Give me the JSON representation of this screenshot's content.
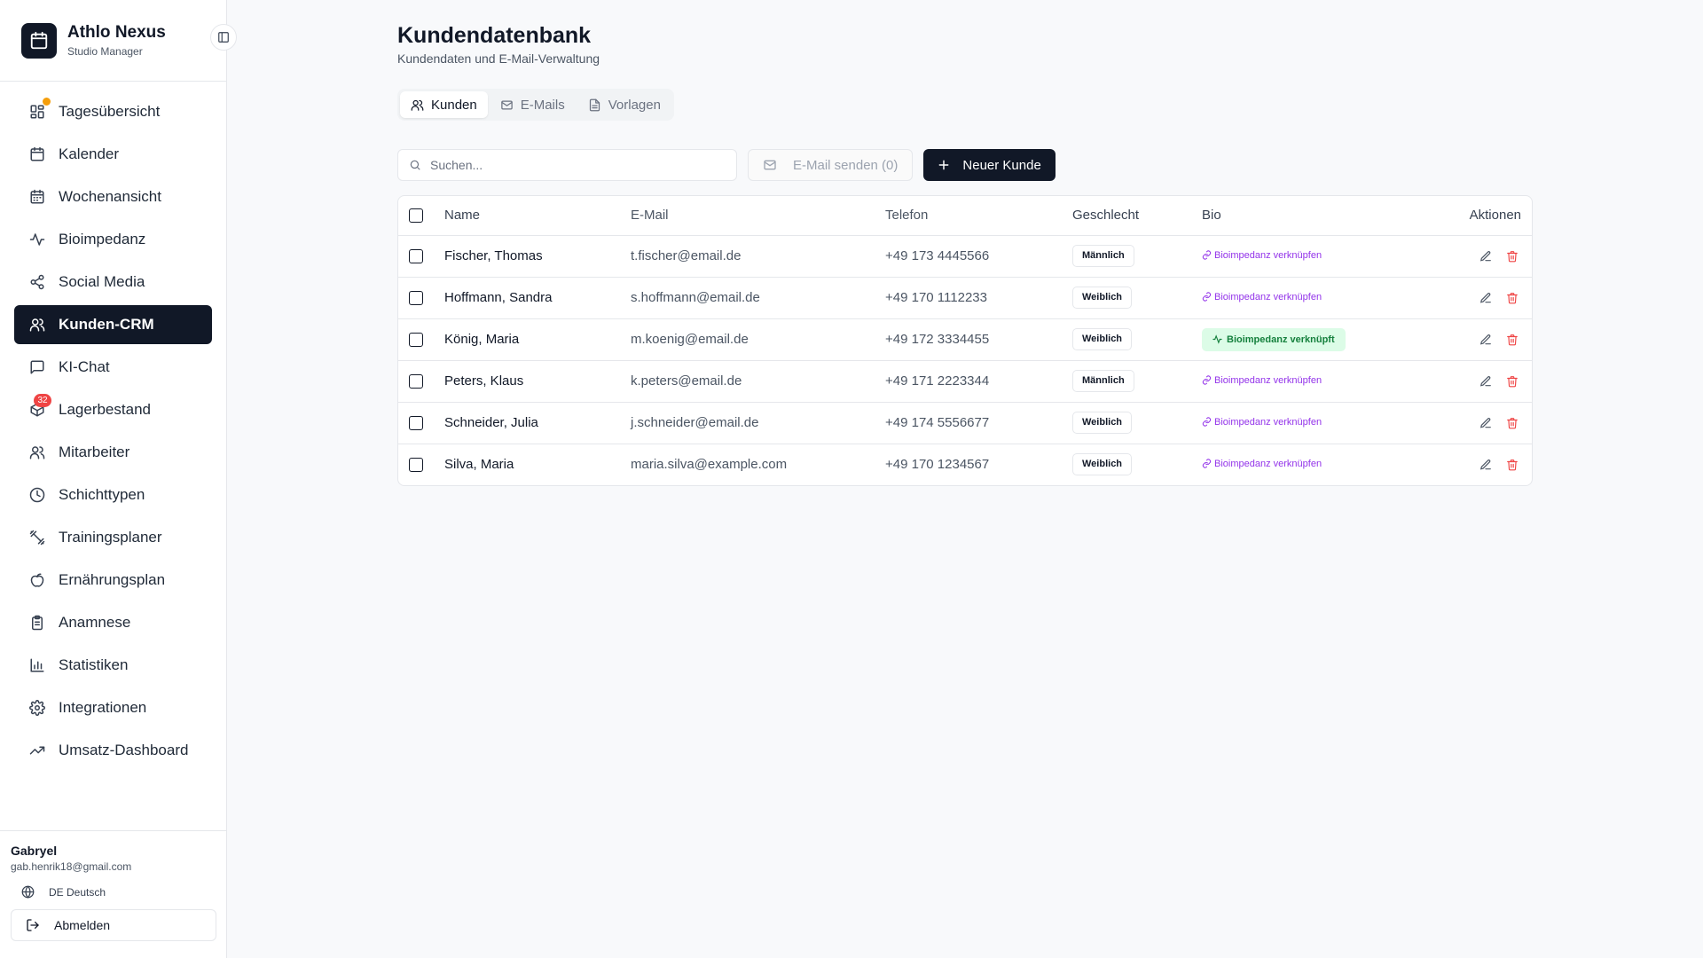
{
  "app": {
    "title": "Athlo Nexus",
    "subtitle": "Studio Manager"
  },
  "sidebar": {
    "items": [
      {
        "label": "Tagesübersicht",
        "icon": "grid-icon",
        "active": false,
        "badge_dot": true
      },
      {
        "label": "Kalender",
        "icon": "calendar-icon",
        "active": false
      },
      {
        "label": "Wochenansicht",
        "icon": "calendar-week-icon",
        "active": false
      },
      {
        "label": "Bioimpedanz",
        "icon": "activity-icon",
        "active": false
      },
      {
        "label": "Social Media",
        "icon": "share-icon",
        "active": false
      },
      {
        "label": "Kunden-CRM",
        "icon": "users-icon",
        "active": true
      },
      {
        "label": "KI-Chat",
        "icon": "chat-icon",
        "active": false
      },
      {
        "label": "Lagerbestand",
        "icon": "package-icon",
        "active": false,
        "badge": "32"
      },
      {
        "label": "Mitarbeiter",
        "icon": "users-icon",
        "active": false
      },
      {
        "label": "Schichttypen",
        "icon": "clock-icon",
        "active": false
      },
      {
        "label": "Trainingsplaner",
        "icon": "dumbbell-icon",
        "active": false
      },
      {
        "label": "Ernährungsplan",
        "icon": "apple-icon",
        "active": false
      },
      {
        "label": "Anamnese",
        "icon": "clipboard-icon",
        "active": false
      },
      {
        "label": "Statistiken",
        "icon": "bar-chart-icon",
        "active": false
      },
      {
        "label": "Integrationen",
        "icon": "settings-icon",
        "active": false
      },
      {
        "label": "Umsatz-Dashboard",
        "icon": "trending-up-icon",
        "active": false
      }
    ]
  },
  "user": {
    "name": "Gabryel",
    "email": "gab.henrik18@gmail.com",
    "language": "DE Deutsch",
    "logout_label": "Abmelden"
  },
  "page": {
    "title": "Kundendatenbank",
    "subtitle": "Kundendaten und E-Mail-Verwaltung"
  },
  "tabs": [
    {
      "label": "Kunden",
      "icon": "users-icon",
      "active": true
    },
    {
      "label": "E-Mails",
      "icon": "mail-icon",
      "active": false
    },
    {
      "label": "Vorlagen",
      "icon": "file-icon",
      "active": false
    }
  ],
  "toolbar": {
    "search_placeholder": "Suchen...",
    "send_email_label": "E-Mail senden (0)",
    "new_customer_label": "Neuer Kunde"
  },
  "table": {
    "columns": [
      "Name",
      "E-Mail",
      "Telefon",
      "Geschlecht",
      "Bio",
      "Aktionen"
    ],
    "rows": [
      {
        "name": "Fischer, Thomas",
        "email": "t.fischer@email.de",
        "phone": "+49 173 4445566",
        "gender": "Männlich",
        "bio": "Bioimpedanz verknüpfen",
        "bio_linked": false
      },
      {
        "name": "Hoffmann, Sandra",
        "email": "s.hoffmann@email.de",
        "phone": "+49 170 1112233",
        "gender": "Weiblich",
        "bio": "Bioimpedanz verknüpfen",
        "bio_linked": false
      },
      {
        "name": "König, Maria",
        "email": "m.koenig@email.de",
        "phone": "+49 172 3334455",
        "gender": "Weiblich",
        "bio": "Bioimpedanz verknüpft",
        "bio_linked": true
      },
      {
        "name": "Peters, Klaus",
        "email": "k.peters@email.de",
        "phone": "+49 171 2223344",
        "gender": "Männlich",
        "bio": "Bioimpedanz verknüpfen",
        "bio_linked": false
      },
      {
        "name": "Schneider, Julia",
        "email": "j.schneider@email.de",
        "phone": "+49 174 5556677",
        "gender": "Weiblich",
        "bio": "Bioimpedanz verknüpfen",
        "bio_linked": false
      },
      {
        "name": "Silva, Maria",
        "email": "maria.silva@example.com",
        "phone": "+49 170 1234567",
        "gender": "Weiblich",
        "bio": "Bioimpedanz verknüpfen",
        "bio_linked": false
      }
    ]
  },
  "colors": {
    "primary": "#111827",
    "accent_purple": "#9333ea",
    "success_bg": "#dcfce7",
    "success_text": "#15803d",
    "danger": "#ef4444",
    "warning": "#f59e0b"
  }
}
